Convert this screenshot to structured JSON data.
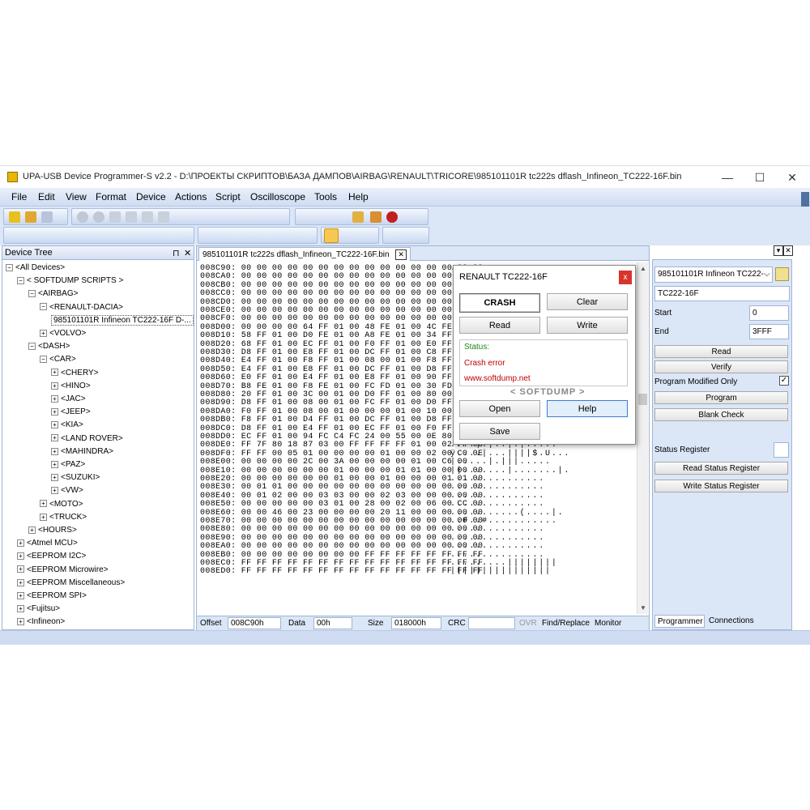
{
  "window": {
    "title": "UPA-USB Device Programmer-S v2.2 - D:\\ПРОЕКТЫ СКРИПТОВ\\БАЗА ДАМПОВ\\AIRBAG\\RENAULT\\TRICORE\\985101101R tc222s dflash_Infineon_TC222-16F.bin",
    "minimize": "—",
    "maximize": "☐",
    "close": "✕"
  },
  "menu": [
    "File",
    "Edit",
    "View",
    "Format",
    "Device",
    "Actions",
    "Script",
    "Oscilloscope",
    "Tools",
    "Help"
  ],
  "tree": {
    "header": "Device Tree",
    "pin": "⊓",
    "close": "✕",
    "items": [
      {
        "label": "<All Devices>",
        "lvl": 0,
        "ex": "−"
      },
      {
        "label": "< SOFTDUMP SCRIPTS >",
        "lvl": 1,
        "ex": "−"
      },
      {
        "label": "<AIRBAG>",
        "lvl": 2,
        "ex": "−"
      },
      {
        "label": "<RENAULT-DACIA>",
        "lvl": 3,
        "ex": "−"
      },
      {
        "label": "985101101R Infineon TC222-16F D-...",
        "lvl": 4,
        "ex": ""
      },
      {
        "label": "<VOLVO>",
        "lvl": 3,
        "ex": "+"
      },
      {
        "label": "<DASH>",
        "lvl": 2,
        "ex": "−"
      },
      {
        "label": "<CAR>",
        "lvl": 3,
        "ex": "−"
      },
      {
        "label": "<CHERY>",
        "lvl": 4,
        "ex": "+"
      },
      {
        "label": "<HINO>",
        "lvl": 4,
        "ex": "+"
      },
      {
        "label": "<JAC>",
        "lvl": 4,
        "ex": "+"
      },
      {
        "label": "<JEEP>",
        "lvl": 4,
        "ex": "+"
      },
      {
        "label": "<KIA>",
        "lvl": 4,
        "ex": "+"
      },
      {
        "label": "<LAND ROVER>",
        "lvl": 4,
        "ex": "+"
      },
      {
        "label": "<MAHINDRA>",
        "lvl": 4,
        "ex": "+"
      },
      {
        "label": "<PAZ>",
        "lvl": 4,
        "ex": "+"
      },
      {
        "label": "<SUZUKI>",
        "lvl": 4,
        "ex": "+"
      },
      {
        "label": "<VW>",
        "lvl": 4,
        "ex": "+"
      },
      {
        "label": "<MOTO>",
        "lvl": 3,
        "ex": "+"
      },
      {
        "label": "<TRUCK>",
        "lvl": 3,
        "ex": "+"
      },
      {
        "label": "<HOURS>",
        "lvl": 2,
        "ex": "+"
      },
      {
        "label": "<Atmel MCU>",
        "lvl": 1,
        "ex": "+"
      },
      {
        "label": "<EEPROM I2C>",
        "lvl": 1,
        "ex": "+"
      },
      {
        "label": "<EEPROM Microwire>",
        "lvl": 1,
        "ex": "+"
      },
      {
        "label": "<EEPROM Miscellaneous>",
        "lvl": 1,
        "ex": "+"
      },
      {
        "label": "<EEPROM SPI>",
        "lvl": 1,
        "ex": "+"
      },
      {
        "label": "<Fujitsu>",
        "lvl": 1,
        "ex": "+"
      },
      {
        "label": "<Infineon>",
        "lvl": 1,
        "ex": "+"
      }
    ]
  },
  "hex": {
    "tab": "985101101R tc222s dflash_Infineon_TC222-16F.bin",
    "tab_close": "✕",
    "rows": [
      "008C90: 00 00 00 00 00 00 00 00 00 00 00 00 00 00 00 00",
      "008CA0: 00 00 00 00 00 00 00 00 00 00 00 00 00 00 00 00",
      "008CB0: 00 00 00 00 00 00 00 00 00 00 00 00 00 00 00 00",
      "008CC0: 00 00 00 00 00 00 00 00 00 00 00 00 00 00 00 00",
      "008CD0: 00 00 00 00 00 00 00 00 00 00 00 00 00 00 00 00",
      "008CE0: 00 00 00 00 00 00 00 00 00 00 00 00 00 00 00 00",
      "008CF0: 00 00 00 00 00 00 00 00 00 00 00 00 00 00 00 00",
      "008D00: 00 00 00 00 64 FF 01 00 48 FE 01 00 4C FE 01 00",
      "008D10: 58 FF 01 00 D0 FE 01 00 A8 FE 01 00 34 FF 01 00",
      "008D20: 68 FF 01 00 EC FF 01 00 F0 FF 01 00 E0 FF 01 00",
      "008D30: D8 FF 01 00 E8 FF 01 00 DC FF 01 00 C8 FF 01 00",
      "008D40: E4 FF 01 00 F8 FF 01 00 08 00 01 00 F8 FF 01 00",
      "008D50: E4 FF 01 00 E8 FF 01 00 DC FF 01 00 D8 FF 01 00",
      "008D60: E0 FF 01 00 E4 FF 01 00 E8 FF 01 00 90 FF 01 00",
      "008D70: B8 FE 01 00 F8 FE 01 00 FC FD 01 00 30 FD 01 00",
      "008D80: 20 FF 01 00 3C 00 01 00 D0 FF 01 00 80 00 01 00",
      "008D90: D8 FF 01 00 08 00 01 00 FC FF 01 00 D0 FF 01 00",
      "008DA0: F0 FF 01 00 08 00 01 00 00 00 01 00 10 00 01 00",
      "008DB0: F8 FF 01 00 D4 FF 01 00 DC FF 01 00 D8 FF 01 00",
      "008DC0: D8 FF 01 00 E4 FF 01 00 EC FF 01 00 F0 FF 01 00",
      "008DD0: EC FF 01 00 94 FC C4 FC 24 00 55 00 0E 80 0C 00",
      "008DE0: FF 7F 80 18 87 03 00 FF FF FF FF 01 00 02 FF 03",
      "008DF0: FF FF 00 05 01 00 00 00 00 01 00 00 02 00 C0 0E",
      "008E00: 00 00 00 00 2C 00 3A 00 00 00 00 01 00 C6 00",
      "008E10: 00 00 00 00 00 00 01 00 00 00 01 01 00 00 00 00",
      "008E20: 00 00 00 00 00 00 01 00 00 01 00 00 00 01 01 00",
      "008E30: 00 01 01 00 00 00 00 00 00 00 00 00 00 00 00 00",
      "008E40: 00 01 02 00 00 03 03 00 00 02 03 00 00 00 00 00",
      "008E50: 00 00 00 00 00 03 01 00 28 00 02 00 06 00 CC 00",
      "008E60: 00 00 46 00 23 00 00 00 00 20 11 00 00 00 00 00",
      "008E70: 00 00 00 00 00 00 00 00 00 00 00 00 00 00 00 00",
      "008E80: 00 00 00 00 00 00 00 00 00 00 00 00 00 00 00 00",
      "008E90: 00 00 00 00 00 00 00 00 00 00 00 00 00 00 00 00",
      "008EA0: 00 00 00 00 00 00 00 00 00 00 00 00 00 00 00 00",
      "008EB0: 00 00 00 00 00 00 00 00 FF FF FF FF FF FF FF FF",
      "008EC0: FF FF FF FF FF FF FF FF FF FF FF FF FF FF FF FF",
      "008ED0: FF FF FF FF FF FF FF FF FF FF FF FF FF FF FF FF"
    ],
    "ascii": [
      ".",
      "",
      "",
      "",
      "",
      "",
      "",
      "",
      "",
      "",
      "",
      "",
      "",
      "",
      "",
      "",
      "",
      "",
      "",
      "",
      "",
      "....|.|..|.|.....",
      "ÿ....|...||||$.U...",
      "|.....|.|||.....",
      "||.......|.......|.",
      "...............",
      "...............",
      "...............",
      "...............",
      "...........(....|.",
      "..F..#...........",
      "...............",
      "...............",
      "...............",
      "...............",
      ".........||||||||",
      "||||||||||||||||",
      "||||||||||||||||"
    ],
    "status": {
      "offset_label": "Offset",
      "offset": "008C90h",
      "data_label": "Data",
      "data": "00h",
      "size_label": "Size",
      "size": "018000h",
      "crc_label": "CRC",
      "crc": "",
      "ovr": "OVR",
      "find": "Find/Replace",
      "monitor": "Monitor"
    }
  },
  "dialog": {
    "title": "RENAULT TC222-16F",
    "close": "x",
    "crash": "CRASH",
    "clear": "Clear",
    "read": "Read",
    "write": "Write",
    "status_label": "Status:",
    "status_msg": "Crash error",
    "site": "www.softdump.net",
    "brand": "< SOFTDUMP >",
    "open": "Open",
    "help": "Help",
    "save": "Save",
    "colors": {
      "status": "#1a8a1a",
      "error": "#c00000"
    }
  },
  "right": {
    "device": "985101101R Infineon TC222-",
    "chip": "TC222-16F",
    "start_label": "Start",
    "start": "0",
    "end_label": "End",
    "end": "3FFF",
    "read": "Read",
    "verify": "Verify",
    "prog_mod": "Program Modified Only",
    "prog_mod_check": "✓",
    "program": "Program",
    "blank": "Blank Check",
    "status_reg": "Status Register",
    "read_sr": "Read Status Register",
    "write_sr": "Write Status Register",
    "tab1": "Programmer",
    "tab2": "Connections"
  }
}
